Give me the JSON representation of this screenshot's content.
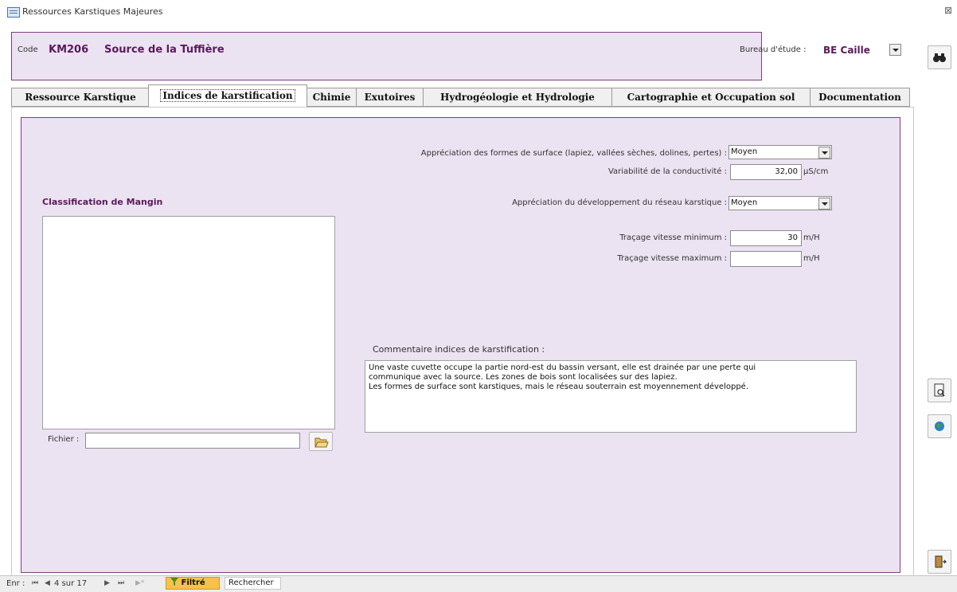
{
  "window": {
    "title": "Ressources Karstiques Majeures",
    "close_glyph": "⊠"
  },
  "header": {
    "code_label": "Code",
    "code_value": "KM206",
    "site_name": "Source de la Tuffière",
    "bureau_label": "Bureau d'étude :",
    "bureau_value": "BE Caille"
  },
  "tabs": [
    {
      "label": "Ressource Karstique"
    },
    {
      "label": "Indices de karstification"
    },
    {
      "label": "Chimie"
    },
    {
      "label": "Exutoires"
    },
    {
      "label": "Hydrogéologie et  Hydrologie"
    },
    {
      "label": "Cartographie et Occupation sol"
    },
    {
      "label": "Documentation"
    }
  ],
  "form": {
    "surface_label": "Appréciation des formes de surface (lapiez, vallées sèches, dolines, pertes) :",
    "surface_value": "Moyen",
    "conductivity_label": "Variabilité de la conductivité :",
    "conductivity_value": "32,00",
    "conductivity_unit": "µS/cm",
    "network_label": "Appréciation du développement du réseau karstique :",
    "network_value": "Moyen",
    "speed_min_label": "Traçage vitesse minimum :",
    "speed_min_value": "30",
    "speed_min_unit": "m/H",
    "speed_max_label": "Traçage vitesse maximum :",
    "speed_max_value": "",
    "speed_max_unit": "m/H",
    "mangin_title": "Classification de Mangin",
    "file_label": "Fichier :",
    "file_value": "",
    "comment_label": "Commentaire indices de karstification :",
    "comment_lines": [
      "Une vaste cuvette occupe la partie nord-est du bassin versant, elle est drainée par une perte qui",
      "communique avec la source. Les zones de bois sont localisées sur des lapiez.",
      "Les formes de surface sont karstiques, mais le réseau souterrain est moyennement développé."
    ]
  },
  "navigation": {
    "record_label": "Enr :",
    "first_glyph": "⏮",
    "prev_glyph": "◀",
    "record_position": "4 sur 17",
    "next_glyph": "▶",
    "last_glyph": "⏭",
    "new_glyph": "▶*",
    "filter_label": "Filtré",
    "search_label": "Rechercher"
  },
  "icons": {
    "binoculars": "binoculars-icon",
    "print_preview": "print-preview-icon",
    "globe": "globe-icon",
    "exit": "exit-door-icon",
    "folder": "folder-open-icon",
    "funnel": "filter-funnel-icon"
  }
}
